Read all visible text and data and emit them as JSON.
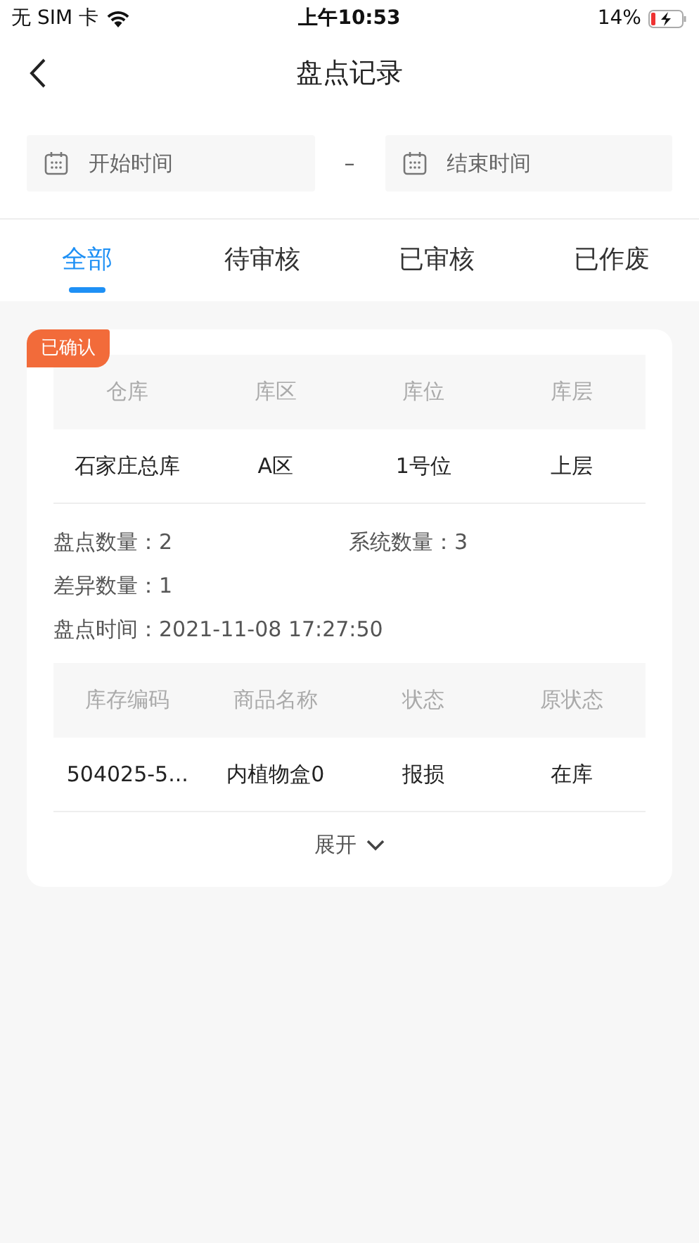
{
  "status_bar": {
    "carrier": "无 SIM 卡",
    "time": "上午10:53",
    "battery": "14%"
  },
  "nav": {
    "title": "盘点记录"
  },
  "date_filter": {
    "start": {
      "placeholder": "开始时间"
    },
    "separator": "–",
    "end": {
      "placeholder": "结束时间"
    }
  },
  "tabs": [
    {
      "label": "全部",
      "selected": true
    },
    {
      "label": "待审核",
      "selected": false
    },
    {
      "label": "已审核",
      "selected": false
    },
    {
      "label": "已作废",
      "selected": false
    }
  ],
  "records": [
    {
      "status": "已确认",
      "location_table": {
        "columns": [
          "仓库",
          "库区",
          "库位",
          "库层"
        ],
        "rows": [
          [
            "石家庄总库",
            "A区",
            "1号位",
            "上层"
          ]
        ]
      },
      "stats": [
        [
          "盘点数量：2",
          "系统数量：3"
        ],
        [
          "差异数量：1"
        ],
        [
          "盘点时间：2021-11-08 17:27:50"
        ]
      ],
      "items_table": {
        "columns": [
          "库存编码",
          "商品名称",
          "状态",
          "原状态"
        ],
        "rows": [
          [
            "504025-5...",
            "内植物盒0",
            "报损",
            "在库"
          ]
        ]
      },
      "expand": "展开"
    }
  ]
}
